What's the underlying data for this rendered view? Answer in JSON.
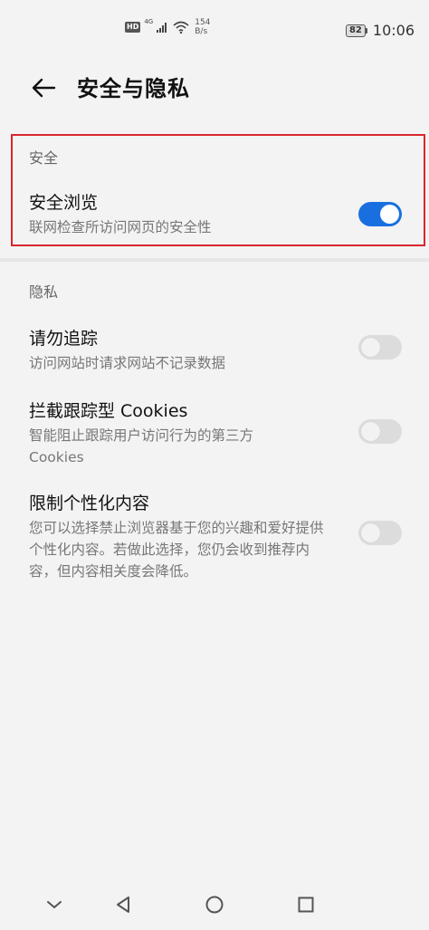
{
  "status_bar": {
    "hd_label": "HD",
    "network_type": "4G",
    "speed_value": "154",
    "speed_unit": "B/s",
    "battery": "82",
    "time": "10:06"
  },
  "header": {
    "title": "安全与隐私"
  },
  "security": {
    "section_label": "安全",
    "safe_browsing": {
      "title": "安全浏览",
      "desc": "联网检查所访问网页的安全性",
      "enabled": true
    }
  },
  "privacy": {
    "section_label": "隐私",
    "items": [
      {
        "title": "请勿追踪",
        "desc": "访问网站时请求网站不记录数据",
        "enabled": false
      },
      {
        "title": "拦截跟踪型 Cookies",
        "desc": "智能阻止跟踪用户访问行为的第三方 Cookies",
        "enabled": false
      },
      {
        "title": "限制个性化内容",
        "desc": "您可以选择禁止浏览器基于您的兴趣和爱好提供个性化内容。若做此选择，您仍会收到推荐内容，但内容相关度会降低。",
        "enabled": false
      }
    ]
  },
  "colors": {
    "accent": "#1a6fe0",
    "highlight_border": "#d9272e",
    "toggle_off": "#dcdcdc"
  },
  "icons": {
    "back": "arrow-left-icon",
    "nav_collapse": "chevron-down-icon",
    "nav_back": "triangle-back-icon",
    "nav_home": "circle-home-icon",
    "nav_recent": "square-recent-icon"
  }
}
